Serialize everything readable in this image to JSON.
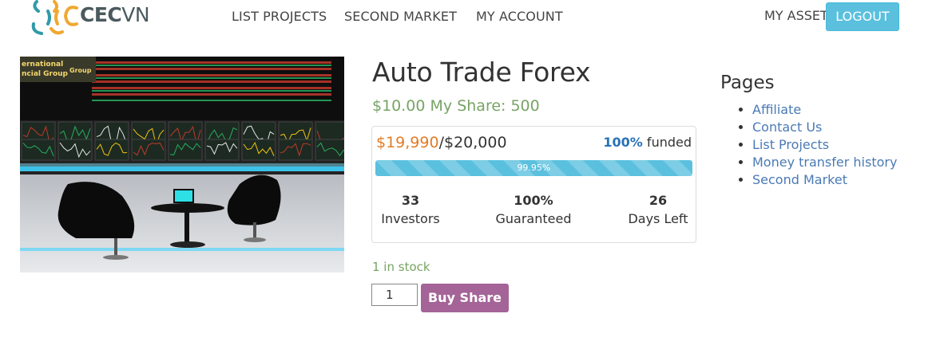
{
  "header": {
    "logo": {
      "text_bold": "CEC",
      "text_light": "VN"
    },
    "nav": [
      {
        "label": "LIST PROJECTS"
      },
      {
        "label": "SECOND MARKET"
      },
      {
        "label": "MY ACCOUNT"
      }
    ],
    "my_asset": "MY ASSET",
    "logout": "LOGOUT"
  },
  "product": {
    "title": "Auto Trade Forex",
    "price_line": "$10.00 My Share: 500",
    "raised_amount": "$19,990",
    "goal": "/$20,000",
    "funded_pct": "100%",
    "funded_label": " funded",
    "progress_label": "99.95%",
    "progress_value": 0.9995,
    "stats": [
      {
        "value": "33",
        "label": "Investors"
      },
      {
        "value": "100%",
        "label": "Guaranteed"
      },
      {
        "value": "26",
        "label": "Days Left"
      }
    ],
    "stock": "1 in stock",
    "quantity": "1",
    "buy_label": "Buy Share"
  },
  "sidebar": {
    "title": "Pages",
    "items": [
      {
        "label": "Affiliate"
      },
      {
        "label": "Contact Us"
      },
      {
        "label": "List Projects"
      },
      {
        "label": "Money transfer history"
      },
      {
        "label": "Second Market"
      }
    ]
  },
  "image_text": {
    "line1": "ernational",
    "line2": "ncial Group",
    "line3": "Group"
  },
  "colors": {
    "accent_blue": "#5bc0de",
    "price_green": "#77a464",
    "raised_orange": "#e27c26",
    "link_blue": "#4a7ab5",
    "buy_purple": "#a46497"
  }
}
